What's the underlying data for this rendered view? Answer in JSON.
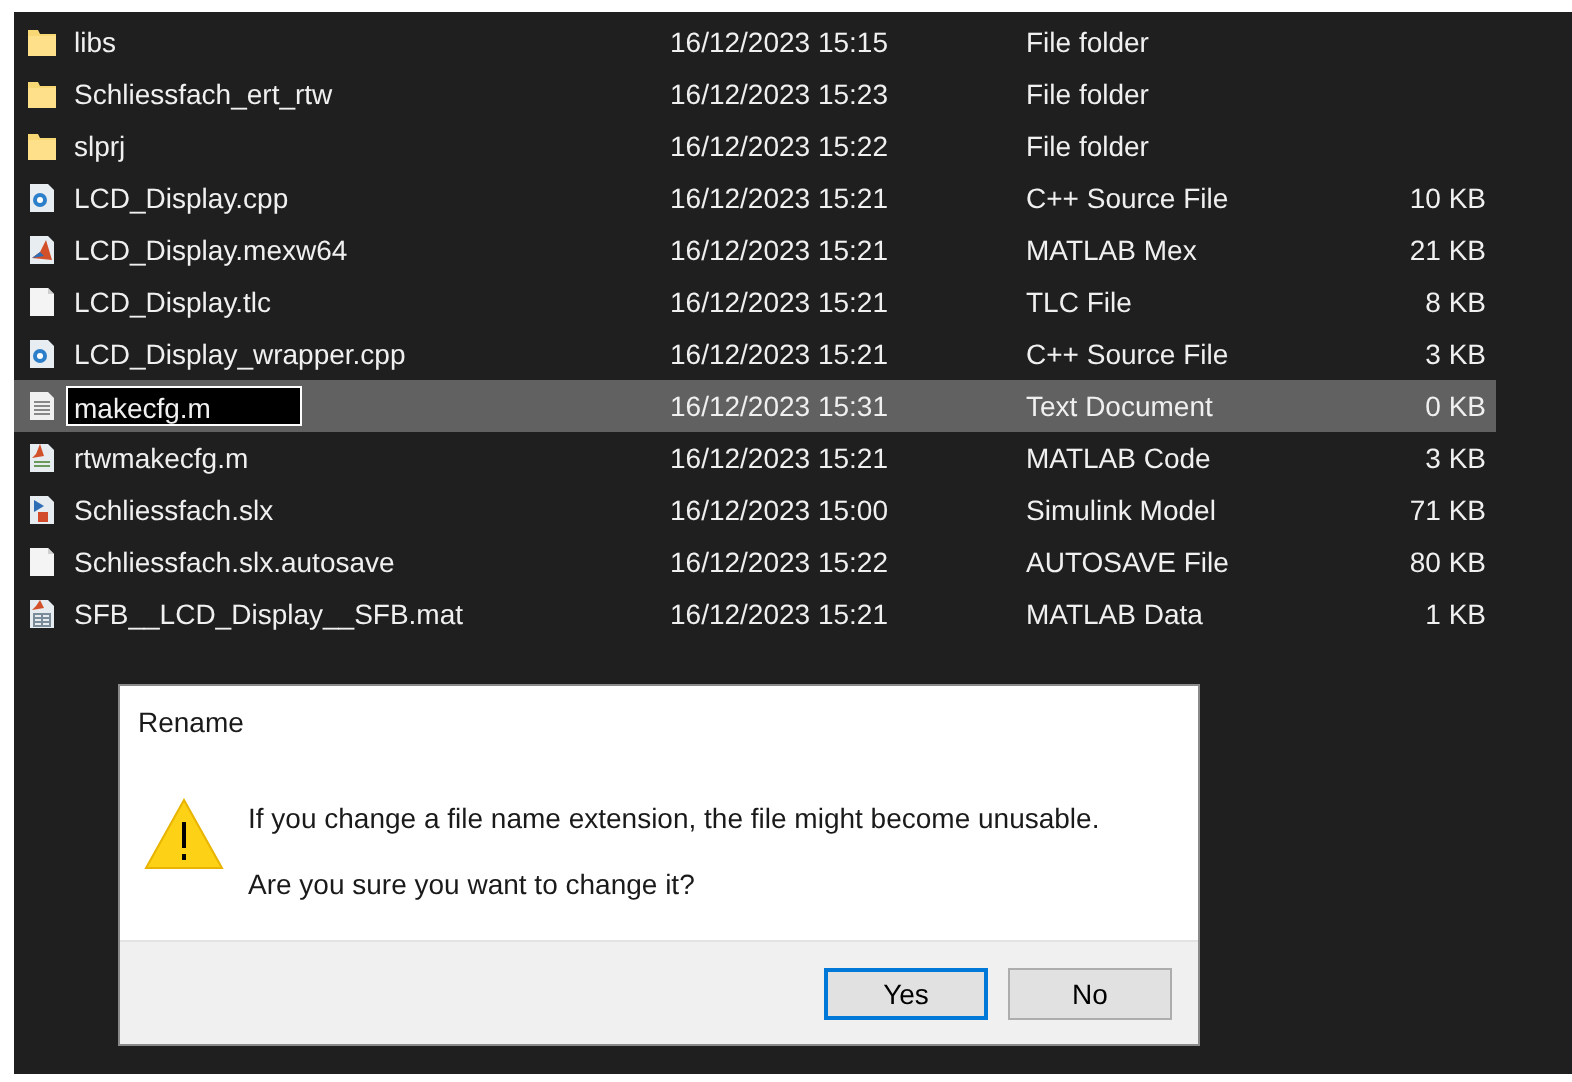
{
  "files": [
    {
      "name": "libs",
      "kind": "folder",
      "modified": "16/12/2023 15:15",
      "type": "File folder",
      "selected": false
    },
    {
      "name": "Schliessfach_ert_rtw",
      "kind": "folder",
      "modified": "16/12/2023 15:23",
      "type": "File folder",
      "selected": false
    },
    {
      "name": "slprj",
      "kind": "folder",
      "modified": "16/12/2023 15:22",
      "type": "File folder",
      "selected": false
    },
    {
      "name": "LCD_Display.cpp",
      "kind": "cpp",
      "modified": "16/12/2023 15:21",
      "type": "C++ Source File",
      "size": "10 KB",
      "selected": false
    },
    {
      "name": "LCD_Display.mexw64",
      "kind": "mex",
      "modified": "16/12/2023 15:21",
      "type": "MATLAB Mex",
      "size": "21 KB",
      "selected": false
    },
    {
      "name": "LCD_Display.tlc",
      "kind": "blank",
      "modified": "16/12/2023 15:21",
      "type": "TLC File",
      "size": "8 KB",
      "selected": false
    },
    {
      "name": "LCD_Display_wrapper.cpp",
      "kind": "cpp",
      "modified": "16/12/2023 15:21",
      "type": "C++ Source File",
      "size": "3 KB",
      "selected": false
    },
    {
      "name": "makecfg.m",
      "kind": "text",
      "modified": "16/12/2023 15:31",
      "type": "Text Document",
      "size": "0 KB",
      "selected": true
    },
    {
      "name": "rtwmakecfg.m",
      "kind": "mcode",
      "modified": "16/12/2023 15:21",
      "type": "MATLAB Code",
      "size": "3 KB",
      "selected": false
    },
    {
      "name": "Schliessfach.slx",
      "kind": "slx",
      "modified": "16/12/2023 15:00",
      "type": "Simulink Model",
      "size": "71 KB",
      "selected": false
    },
    {
      "name": "Schliessfach.slx.autosave",
      "kind": "blank",
      "modified": "16/12/2023 15:22",
      "type": "AUTOSAVE File",
      "size": "80 KB",
      "selected": false
    },
    {
      "name": "SFB__LCD_Display__SFB.mat",
      "kind": "mat",
      "modified": "16/12/2023 15:21",
      "type": "MATLAB Data",
      "size": "1 KB",
      "selected": false
    }
  ],
  "dialog": {
    "title": "Rename",
    "message": "If you change a file name extension, the file might become unusable.",
    "question": "Are you sure you want to change it?",
    "buttons": [
      {
        "label": "Yes",
        "default": true
      },
      {
        "label": "No",
        "default": false
      }
    ]
  }
}
